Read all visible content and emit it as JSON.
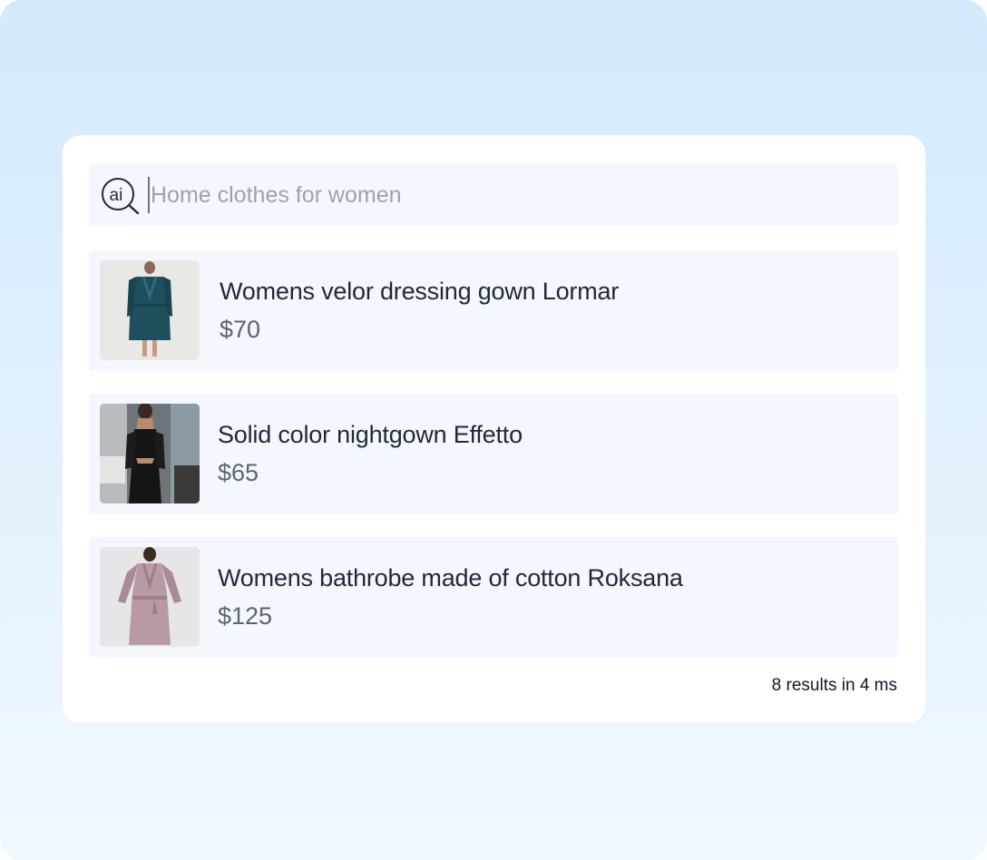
{
  "search": {
    "placeholder": "Home clothes for women",
    "value": "",
    "icon": "ai-search-icon"
  },
  "results": [
    {
      "name": "Womens velor dressing gown Lormar",
      "price": "$70",
      "image": "teal-velour-robe-photo"
    },
    {
      "name": "Solid color nightgown Effetto",
      "price": "$65",
      "image": "black-nightgown-photo"
    },
    {
      "name": "Womens bathrobe made of cotton Roksana",
      "price": "$125",
      "image": "mauve-cotton-bathrobe-photo"
    }
  ],
  "footer": {
    "results_count": "8 results in 4 ms"
  },
  "colors": {
    "background_top": "#d3eafd",
    "background_bottom": "#f1f8fe",
    "card": "#ffffff",
    "row": "#f4f7fe",
    "title_text": "#1f2937",
    "price_text": "#5b6472",
    "placeholder_text": "#9ca3af"
  }
}
